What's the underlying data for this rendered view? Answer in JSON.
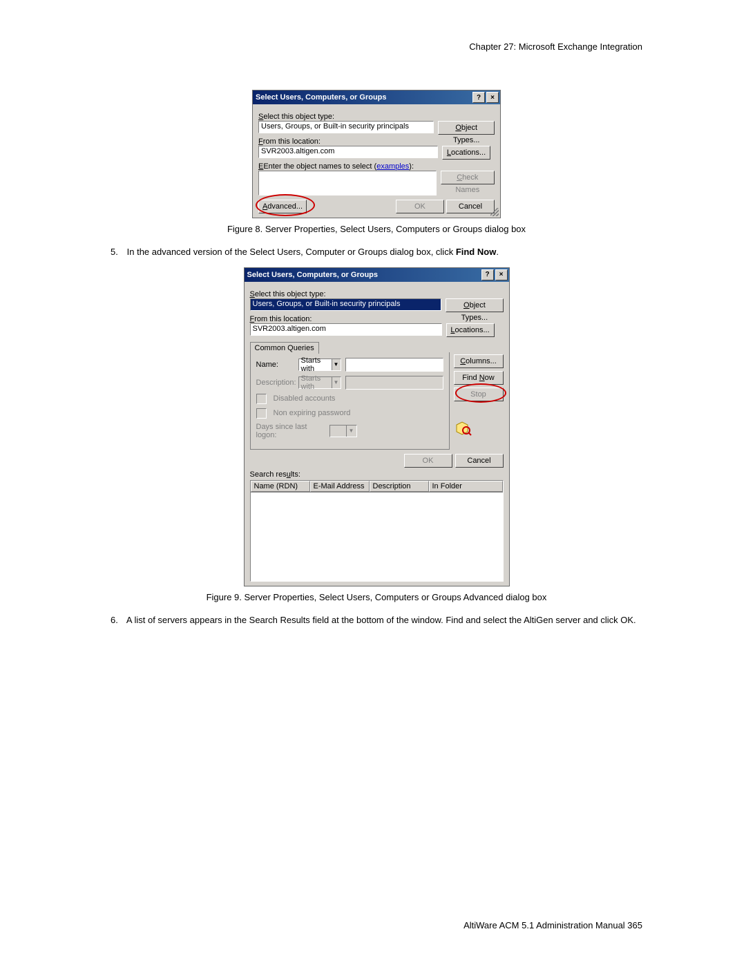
{
  "header": "Chapter 27:  Microsoft Exchange Integration",
  "dlg1": {
    "title": "Select Users, Computers, or Groups",
    "help": "?",
    "close": "×",
    "object_type_label": "Select this object type:",
    "object_type_value": "Users, Groups, or Built-in security principals",
    "object_types_btn": "Object Types...",
    "location_label": "From this location:",
    "location_value": "SVR2003.altigen.com",
    "locations_btn": "Locations...",
    "names_label_a": "Enter the object names to select (",
    "names_label_link": "examples",
    "names_label_b": "):",
    "check_names_btn": "Check Names",
    "advanced_btn": "Advanced...",
    "ok_btn": "OK",
    "cancel_btn": "Cancel"
  },
  "caption1": "Figure 8.   Server Properties, Select Users, Computers or Groups dialog box",
  "step5": {
    "num": "5.",
    "text_a": "In the advanced version of the Select Users, Computer or Groups dialog box, click ",
    "text_bold": "Find Now",
    "text_b": "."
  },
  "dlg2": {
    "title": "Select Users, Computers, or Groups",
    "help": "?",
    "close": "×",
    "object_type_label": "Select this object type:",
    "object_type_value": "Users, Groups, or Built-in security principals",
    "object_types_btn": "Object Types...",
    "location_label": "From this location:",
    "location_value": "SVR2003.altigen.com",
    "locations_btn": "Locations...",
    "tab": "Common Queries",
    "name_label": "Name:",
    "name_combo": "Starts with",
    "desc_label": "Description:",
    "desc_combo": "Starts with",
    "chk_disabled": "Disabled accounts",
    "chk_nonexp": "Non expiring password",
    "days_label": "Days since last logon:",
    "columns_btn": "Columns...",
    "findnow_btn": "Find Now",
    "stop_btn": "Stop",
    "ok_btn": "OK",
    "cancel_btn": "Cancel",
    "results_label": "Search results:",
    "col1": "Name (RDN)",
    "col2": "E-Mail Address",
    "col3": "Description",
    "col4": "In Folder"
  },
  "caption2": "Figure 9.   Server Properties, Select Users, Computers or Groups Advanced dialog box",
  "step6": {
    "num": "6.",
    "text": "A list of servers appears in the Search Results field at the bottom of the window. Find and select the AltiGen server and click OK."
  },
  "footer": "AltiWare ACM 5.1 Administration Manual   365"
}
